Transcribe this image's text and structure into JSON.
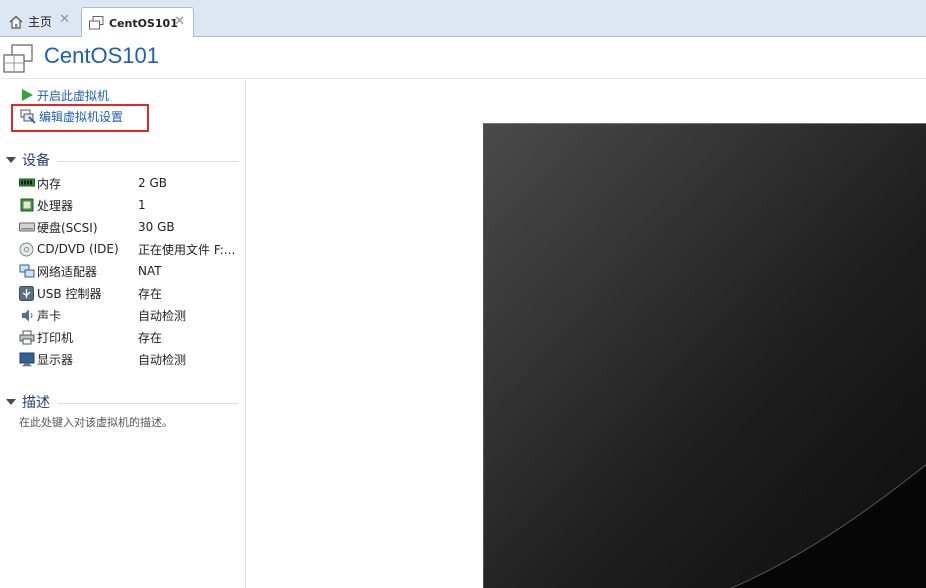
{
  "tabs": {
    "home_label": "主页",
    "vm_label": "CentOS101",
    "close_glyph": "✕"
  },
  "header": {
    "title": "CentOS101",
    "icon": "vm-icon"
  },
  "actions": {
    "start_label": "开启此虚拟机",
    "edit_label": "编辑虚拟机设置"
  },
  "devices": {
    "title": "设备",
    "items": [
      {
        "icon": "memory-icon",
        "name": "内存",
        "value": "2 GB"
      },
      {
        "icon": "processor-icon",
        "name": "处理器",
        "value": "1"
      },
      {
        "icon": "harddisk-icon",
        "name": "硬盘(SCSI)",
        "value": "30 GB"
      },
      {
        "icon": "cd-dvd-icon",
        "name": "CD/DVD (IDE)",
        "value": "正在使用文件 F:..."
      },
      {
        "icon": "network-icon",
        "name": "网络适配器",
        "value": "NAT"
      },
      {
        "icon": "usb-icon",
        "name": "USB 控制器",
        "value": "存在"
      },
      {
        "icon": "sound-icon",
        "name": "声卡",
        "value": "自动检测"
      },
      {
        "icon": "printer-icon",
        "name": "打印机",
        "value": "存在"
      },
      {
        "icon": "display-icon",
        "name": "显示器",
        "value": "自动检测"
      }
    ]
  },
  "description": {
    "title": "描述",
    "placeholder": "在此处键入对该虚拟机的描述。"
  },
  "colors": {
    "accent": "#1f5eb8",
    "title": "#1c5fb5",
    "highlight": "#e0282b",
    "screen": "#1a1a1a"
  }
}
